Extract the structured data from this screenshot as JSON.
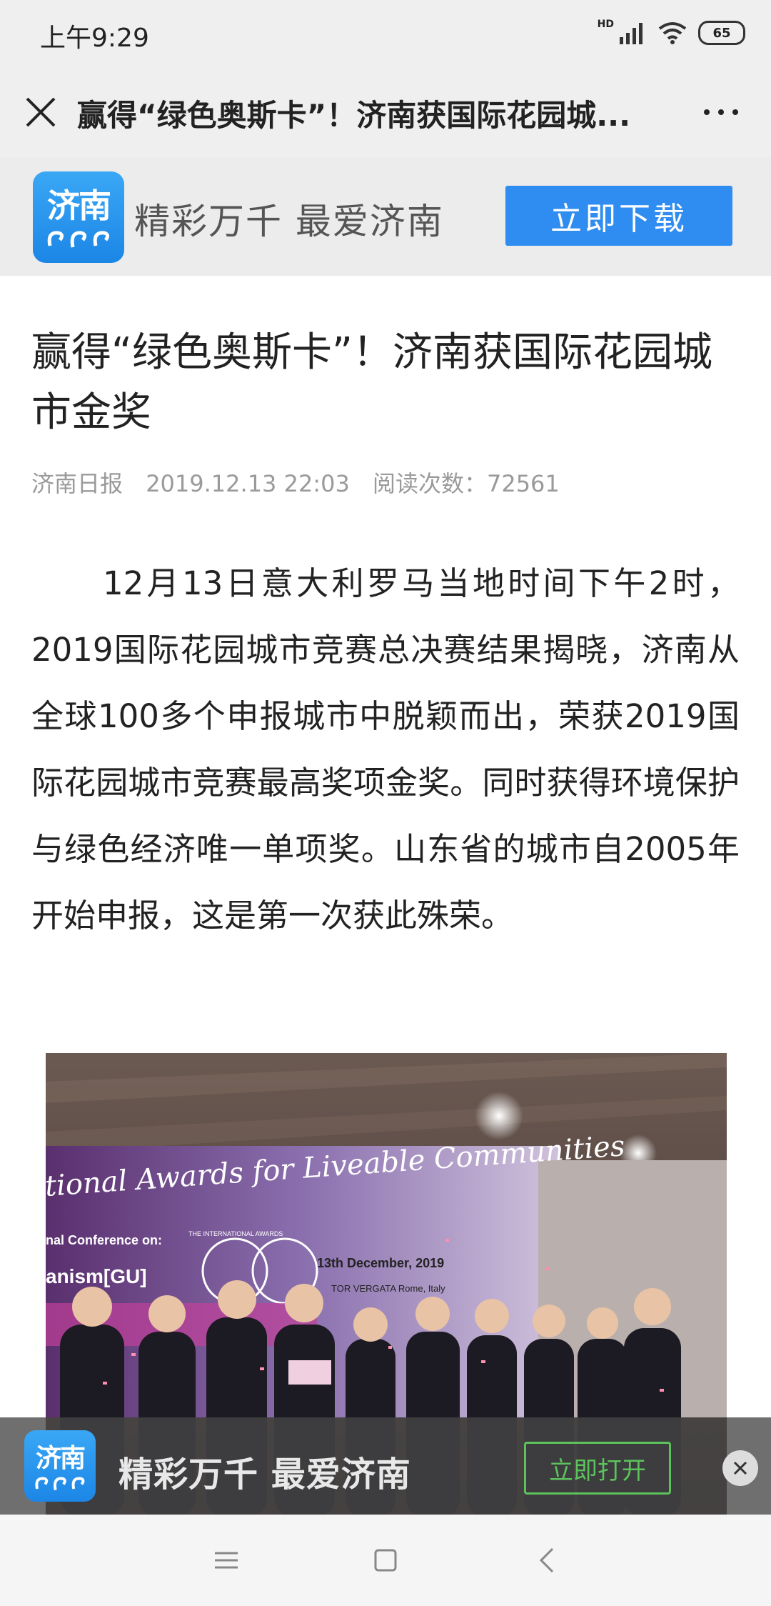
{
  "status": {
    "time": "上午9:29",
    "hd": "HD",
    "battery": "65"
  },
  "nav": {
    "title": "赢得“绿色奥斯卡”！济南获国际花园城..."
  },
  "banner": {
    "logo_text": "济南",
    "slogan": "精彩万千 最爱济南",
    "download_label": "立即下载"
  },
  "article": {
    "title": "赢得“绿色奥斯卡”！济南获国际花园城市金奖",
    "source": "济南日报",
    "datetime": "2019.12.13 22:03",
    "reads": "阅读次数：72561",
    "body": "12月13日意大利罗马当地时间下午2时，2019国际花园城市竞赛总决赛结果揭晓，济南从全球100多个申报城市中脱颖而出，荣获2019国际花园城市竞赛最高奖项金奖。同时获得环境保护与绿色经济唯一单项奖。山东省的城市自2005年开始申报，这是第一次获此殊荣。"
  },
  "photo": {
    "banner_line1": "tional Awards for Liveable Communities",
    "banner_small": "THE INTERNATIONAL AWARDS",
    "conference": "nal Conference on:",
    "urbanism": "anism[GU]",
    "date_line": "13th December, 2019",
    "place": "TOR VERGATA  Rome, Italy"
  },
  "floatbar": {
    "logo_text": "济南",
    "slogan": "精彩万千 最爱济南",
    "open_label": "立即打开"
  },
  "colors": {
    "accent": "#2f8cf0",
    "open_green": "#5cc35c"
  }
}
